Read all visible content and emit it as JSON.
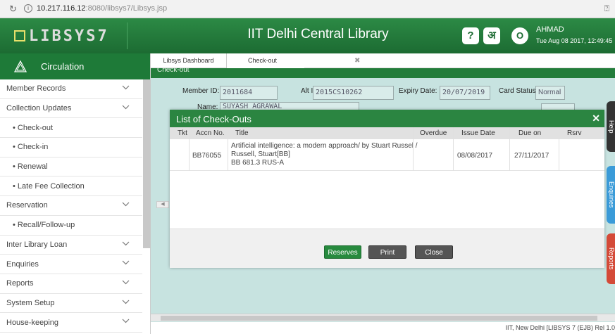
{
  "browser": {
    "url_host": "10.217.116.12",
    "url_rest": ":8080/libsys7/Libsys.jsp"
  },
  "header": {
    "logo_text": "LIBSYS7",
    "app_title": "IIT Delhi Central Library",
    "user_initial": "O",
    "user_name": "AHMAD",
    "datetime": "Tue Aug 08 2017, 12:49:45"
  },
  "sidebar": {
    "title": "Circulation",
    "items": [
      {
        "label": "Member Records",
        "chev": true,
        "sub": false
      },
      {
        "label": "Collection Updates",
        "chev": true,
        "sub": false
      },
      {
        "label": "• Check-out",
        "chev": false,
        "sub": true
      },
      {
        "label": "• Check-in",
        "chev": false,
        "sub": true
      },
      {
        "label": "• Renewal",
        "chev": false,
        "sub": true
      },
      {
        "label": "• Late Fee Collection",
        "chev": false,
        "sub": true
      },
      {
        "label": "Reservation",
        "chev": true,
        "sub": false
      },
      {
        "label": "• Recall/Follow-up",
        "chev": false,
        "sub": true
      },
      {
        "label": "Inter Library Loan",
        "chev": true,
        "sub": false
      },
      {
        "label": "Enquiries",
        "chev": true,
        "sub": false
      },
      {
        "label": "Reports",
        "chev": true,
        "sub": false
      },
      {
        "label": "System Setup",
        "chev": true,
        "sub": false
      },
      {
        "label": "House-keeping",
        "chev": true,
        "sub": false
      }
    ]
  },
  "tabs": {
    "dashboard": "Libsys Dashboard",
    "checkout": "Check-out"
  },
  "panel_title": "Check-out",
  "form": {
    "member_id_label": "Member ID:",
    "member_id": "2011684",
    "alt_id_label": "Alt Id:",
    "alt_id": "2015CS10262",
    "expiry_label": "Expiry Date:",
    "expiry": "20/07/2019",
    "card_status_label": "Card Status",
    "card_status": "Normal",
    "name_label": "Name:",
    "name": "SUYASH AGRAWAL"
  },
  "side_tabs": {
    "help": "Help",
    "enquiries": "Enquiries",
    "reports": "Reports"
  },
  "footer": "IIT, New Delhi [LIBSYS 7 (EJB) Rel 1.0",
  "modal": {
    "title": "List of Check-Outs",
    "columns": [
      "Tkt",
      "Accn No.",
      "Title",
      "Overdue",
      "Issue Date",
      "Due on",
      "Rsrv"
    ],
    "rows": [
      {
        "tkt": "",
        "accn": "BB76055",
        "title_line1": "Artificial intelligence: a modern approach/ by Stuart Russel /",
        "title_line2": "Russell, Stuart[BB]",
        "title_line3": "BB 681.3 RUS-A",
        "overdue": "",
        "issue_date": "08/08/2017",
        "due_on": "27/11/2017",
        "rsrv": ""
      }
    ],
    "buttons": {
      "reserves": "Reserves",
      "print": "Print",
      "close": "Close"
    }
  }
}
